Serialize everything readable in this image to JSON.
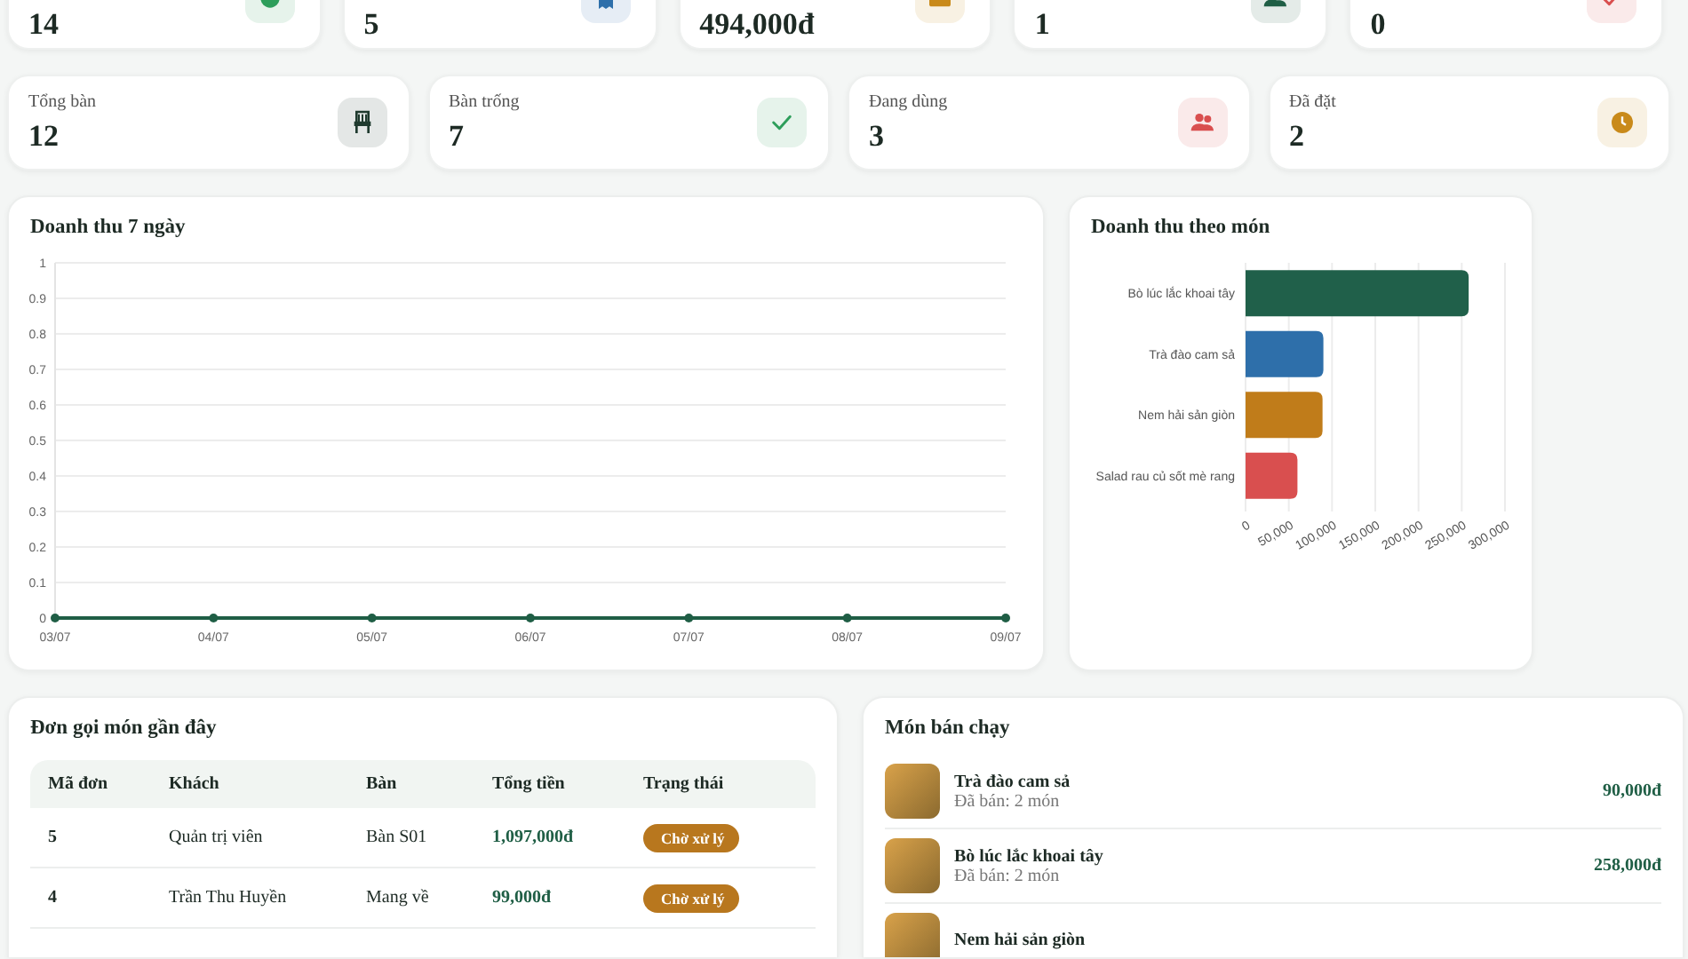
{
  "top_stats": [
    {
      "value": "14",
      "color": "#2e9e5b",
      "kind": "dot"
    },
    {
      "value": "5",
      "color": "#2e6faa",
      "kind": "receipt"
    },
    {
      "value": "494,000đ",
      "color": "#c98a1a",
      "kind": "wallet"
    },
    {
      "value": "1",
      "color": "#1f5e45",
      "kind": "users"
    },
    {
      "value": "0",
      "color": "#d94f4f",
      "kind": "check"
    }
  ],
  "table_stats": [
    {
      "label": "Tổng bàn",
      "value": "12",
      "color": "#1f3a2e",
      "kind": "chair"
    },
    {
      "label": "Bàn trống",
      "value": "7",
      "color": "#2e9e5b",
      "kind": "check"
    },
    {
      "label": "Đang dùng",
      "value": "3",
      "color": "#d94f4f",
      "kind": "users"
    },
    {
      "label": "Đã đặt",
      "value": "2",
      "color": "#c98a1a",
      "kind": "clock"
    }
  ],
  "revenue_7_days": {
    "title": "Doanh thu 7 ngày",
    "chart_data": {
      "type": "line",
      "categories": [
        "03/07",
        "04/07",
        "05/07",
        "06/07",
        "07/07",
        "08/07",
        "09/07"
      ],
      "series": [
        {
          "color": "#1f5e45",
          "values": [
            0,
            0,
            0,
            0,
            0,
            0,
            0
          ],
          "marker": true
        }
      ],
      "grid": true,
      "ylim": [
        0,
        1
      ],
      "yticks": [
        0,
        0.1,
        0.2,
        0.3,
        0.4,
        0.5,
        0.6,
        0.7,
        0.8,
        0.9,
        1
      ]
    }
  },
  "revenue_by_dish": {
    "title": "Doanh thu theo món",
    "chart_data": {
      "type": "bar",
      "orientation": "horizontal",
      "categories": [
        "Bò lúc lắc khoai tây",
        "Trà đào cam sả",
        "Nem hải sản giòn",
        "Salad rau củ sốt mè rang"
      ],
      "values": [
        258000,
        90000,
        89000,
        60000
      ],
      "grid": true,
      "xlim": [
        0,
        300000
      ],
      "xticks": [
        {
          "value": 0,
          "label": "0"
        },
        {
          "value": 50000,
          "label": "50,000"
        },
        {
          "value": 100000,
          "label": "100,000"
        },
        {
          "value": 150000,
          "label": "150,000"
        },
        {
          "value": 200000,
          "label": "200,000"
        },
        {
          "value": 250000,
          "label": "250,000"
        },
        {
          "value": 300000,
          "label": "300,000"
        }
      ]
    }
  },
  "recent_orders": {
    "title": "Đơn gọi món gần đây",
    "columns": [
      "Mã đơn",
      "Khách",
      "Bàn",
      "Tổng tiền",
      "Trạng thái"
    ],
    "rows": [
      {
        "id": "5",
        "customer": "Quản trị viên",
        "table": "Bàn S01",
        "total": "1,097,000đ",
        "status": "Chờ xử lý",
        "kind": "pending"
      },
      {
        "id": "4",
        "customer": "Trần Thu Huyền",
        "table": "Mang về",
        "total": "99,000đ",
        "status": "Chờ xử lý",
        "kind": "pending"
      }
    ]
  },
  "best_sellers": {
    "title": "Món bán chạy",
    "items": [
      {
        "name": "Trà đào cam sả",
        "sold": "Đã bán: 2 món",
        "revenue": "90,000đ"
      },
      {
        "name": "Bò lúc lắc khoai tây",
        "sold": "Đã bán: 2 món",
        "revenue": "258,000đ"
      },
      {
        "name": "Nem hải sản giòn"
      }
    ]
  }
}
